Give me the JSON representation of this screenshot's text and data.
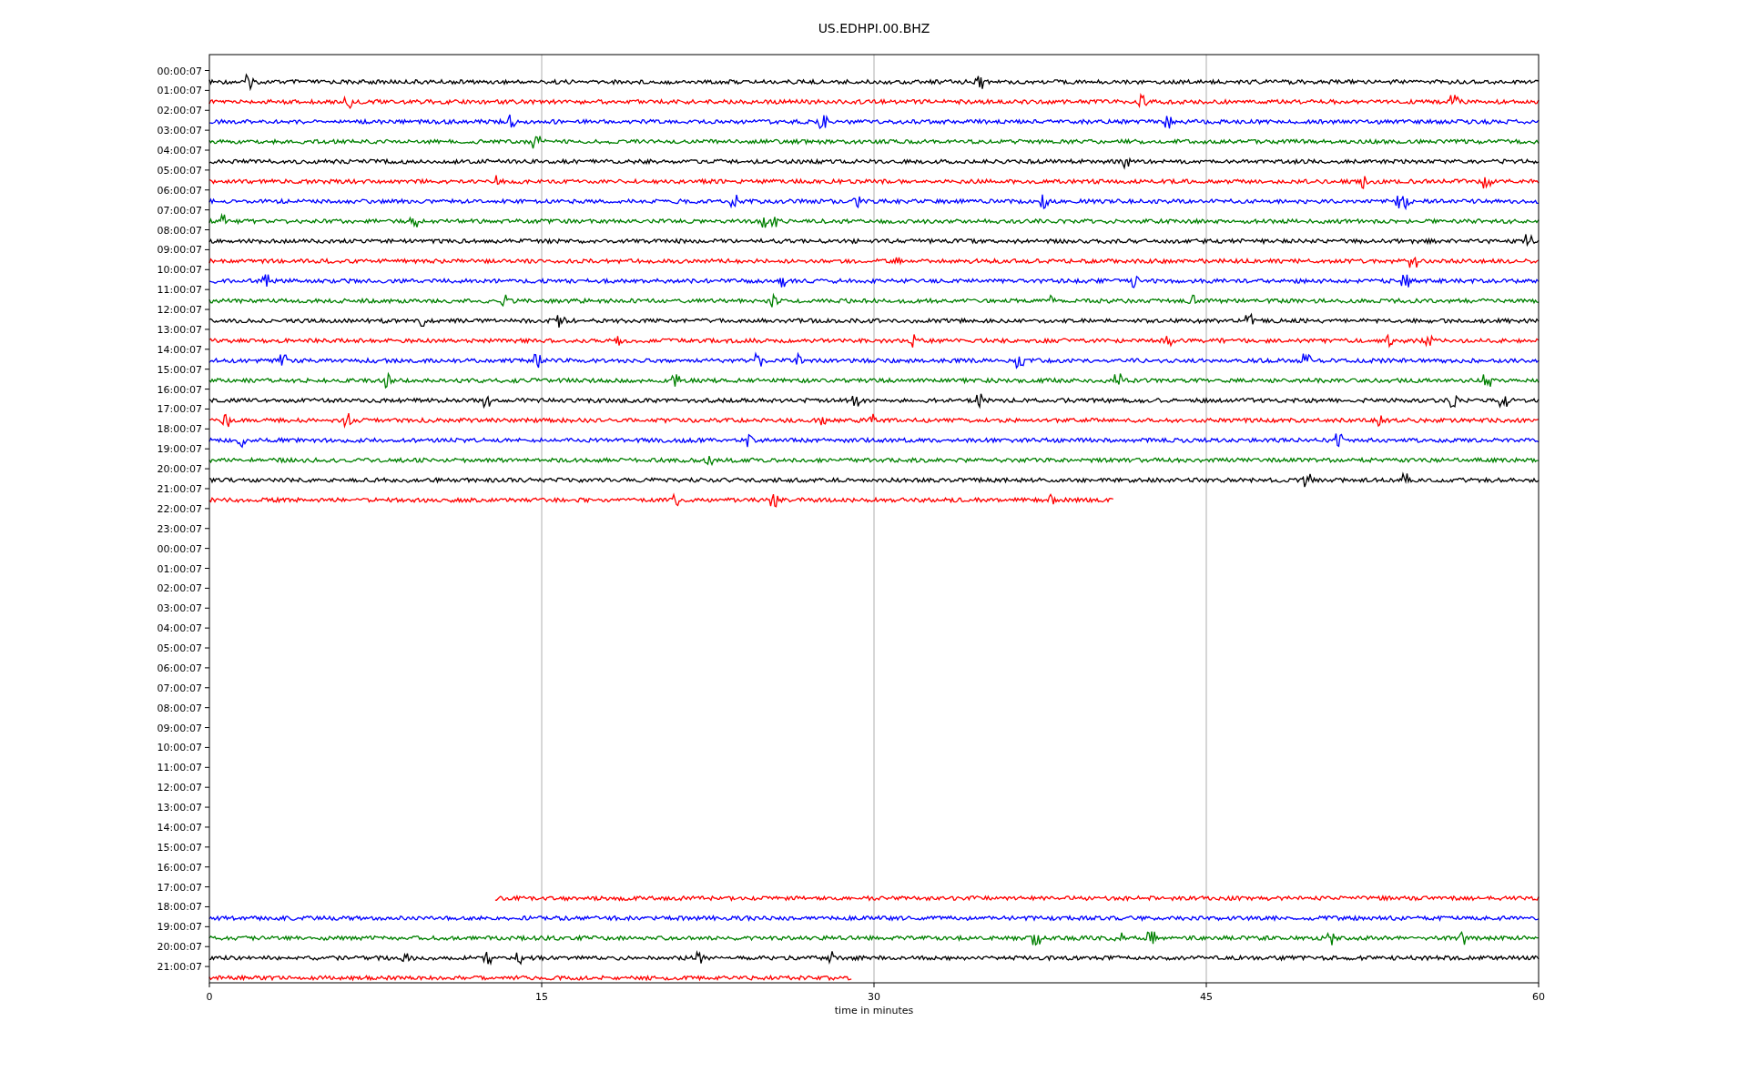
{
  "title": "US.EDHPI.00.BHZ",
  "plot": {
    "xlabel": "time in minutes",
    "xticks": [
      "0",
      "15",
      "30",
      "45",
      "60"
    ],
    "rows": [
      {
        "label": "00:00:07",
        "trace": {
          "color": "#000000",
          "kind": "full",
          "level": 1
        }
      },
      {
        "label": "01:00:07",
        "trace": {
          "color": "#ff0000",
          "kind": "full",
          "level": 1
        }
      },
      {
        "label": "02:00:07",
        "trace": {
          "color": "#0000ff",
          "kind": "full",
          "level": 1
        }
      },
      {
        "label": "03:00:07",
        "trace": {
          "color": "#008000",
          "kind": "full",
          "level": 1
        }
      },
      {
        "label": "04:00:07",
        "trace": {
          "color": "#000000",
          "kind": "full",
          "level": 1
        }
      },
      {
        "label": "05:00:07",
        "trace": {
          "color": "#ff0000",
          "kind": "full",
          "level": 1
        }
      },
      {
        "label": "06:00:07",
        "trace": {
          "color": "#0000ff",
          "kind": "full",
          "level": 1
        }
      },
      {
        "label": "07:00:07",
        "trace": {
          "color": "#008000",
          "kind": "full",
          "level": 1
        }
      },
      {
        "label": "08:00:07",
        "trace": {
          "color": "#000000",
          "kind": "full",
          "level": 1
        }
      },
      {
        "label": "09:00:07",
        "trace": {
          "color": "#ff0000",
          "kind": "full",
          "level": 1
        }
      },
      {
        "label": "10:00:07",
        "trace": {
          "color": "#0000ff",
          "kind": "full",
          "level": 1
        }
      },
      {
        "label": "11:00:07",
        "trace": {
          "color": "#008000",
          "kind": "full",
          "level": 1
        }
      },
      {
        "label": "12:00:07",
        "trace": {
          "color": "#000000",
          "kind": "full",
          "level": 1
        }
      },
      {
        "label": "13:00:07",
        "trace": {
          "color": "#ff0000",
          "kind": "full",
          "level": 1
        }
      },
      {
        "label": "14:00:07",
        "trace": {
          "color": "#0000ff",
          "kind": "full",
          "level": 1
        }
      },
      {
        "label": "15:00:07",
        "trace": {
          "color": "#008000",
          "kind": "full",
          "level": 1
        }
      },
      {
        "label": "16:00:07",
        "trace": {
          "color": "#000000",
          "kind": "full",
          "level": 1
        }
      },
      {
        "label": "17:00:07",
        "trace": {
          "color": "#ff0000",
          "kind": "full",
          "level": 1
        }
      },
      {
        "label": "18:00:07",
        "trace": {
          "color": "#0000ff",
          "kind": "full",
          "level": 1
        }
      },
      {
        "label": "19:00:07",
        "trace": {
          "color": "#008000",
          "kind": "full",
          "level": 1
        }
      },
      {
        "label": "20:00:07",
        "trace": {
          "color": "#000000",
          "kind": "full",
          "level": 1
        }
      },
      {
        "label": "21:00:07",
        "trace": {
          "color": "#ff0000",
          "kind": "from-start",
          "level": 0.68
        }
      },
      {
        "label": "22:00:07"
      },
      {
        "label": "23:00:07"
      },
      {
        "label": "00:00:07"
      },
      {
        "label": "01:00:07"
      },
      {
        "label": "02:00:07"
      },
      {
        "label": "03:00:07"
      },
      {
        "label": "04:00:07"
      },
      {
        "label": "05:00:07"
      },
      {
        "label": "06:00:07"
      },
      {
        "label": "07:00:07"
      },
      {
        "label": "08:00:07"
      },
      {
        "label": "09:00:07"
      },
      {
        "label": "10:00:07"
      },
      {
        "label": "11:00:07"
      },
      {
        "label": "12:00:07"
      },
      {
        "label": "13:00:07"
      },
      {
        "label": "14:00:07"
      },
      {
        "label": "15:00:07"
      },
      {
        "label": "16:00:07"
      },
      {
        "label": "17:00:07",
        "trace": {
          "color": "#ff0000",
          "kind": "to-end",
          "level": 0.785
        }
      },
      {
        "label": "18:00:07",
        "trace": {
          "color": "#0000ff",
          "kind": "full",
          "level": 1
        }
      },
      {
        "label": "19:00:07",
        "trace": {
          "color": "#008000",
          "kind": "full",
          "level": 1
        }
      },
      {
        "label": "20:00:07",
        "trace": {
          "color": "#000000",
          "kind": "full",
          "level": 1
        }
      },
      {
        "label": "21:00:07",
        "trace": {
          "color": "#ff0000",
          "kind": "from-start",
          "level": 0.483
        }
      }
    ]
  }
}
